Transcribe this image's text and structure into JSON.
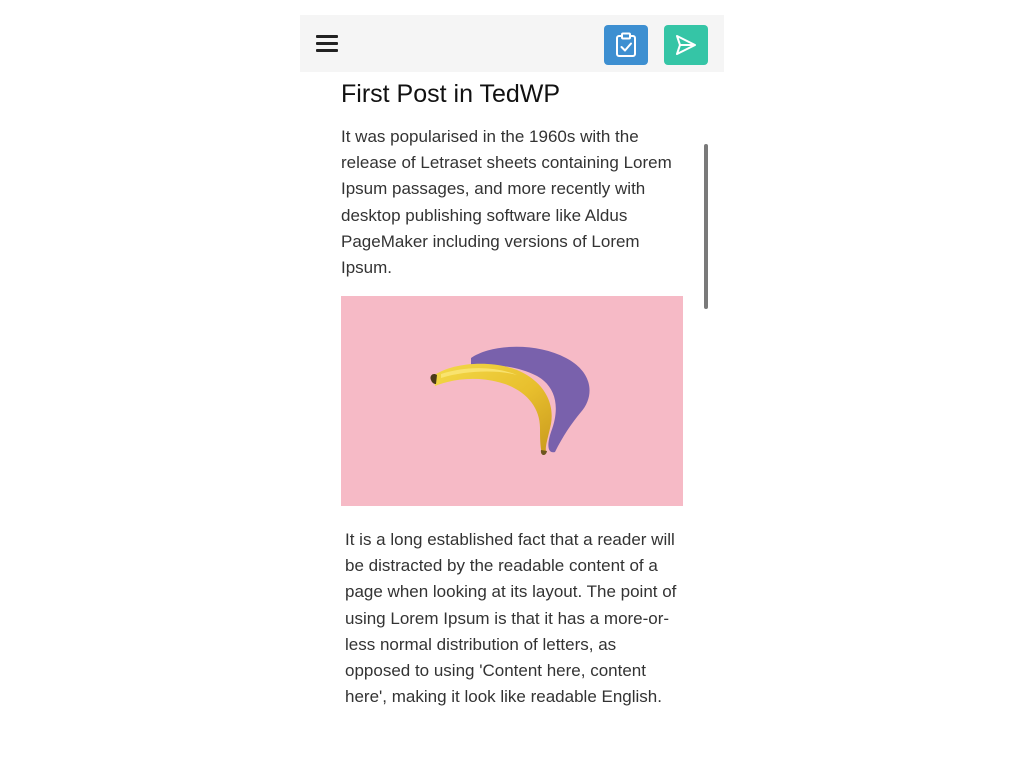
{
  "toolbar": {
    "menu_icon": "hamburger-menu-icon",
    "review_button": {
      "icon": "clipboard-check-icon",
      "color": "#3d8fd1"
    },
    "send_button": {
      "icon": "send-icon",
      "color": "#35c5a6"
    }
  },
  "post": {
    "title": "First Post in TedWP",
    "paragraph_1": " It was popularised in the 1960s with the release of Letraset sheets containing Lorem Ipsum passages, and more recently with desktop publishing software like Aldus PageMaker including versions of Lorem Ipsum.",
    "image": {
      "subject": "banana",
      "background": "#f6bac6"
    },
    "paragraph_2": "It is a long established fact that a reader will be distracted by the readable content of a page when looking at its layout. The point of using Lorem Ipsum is that it has a more-or-less normal distribution of letters, as opposed to using 'Content here, content here', making it look like readable English."
  }
}
